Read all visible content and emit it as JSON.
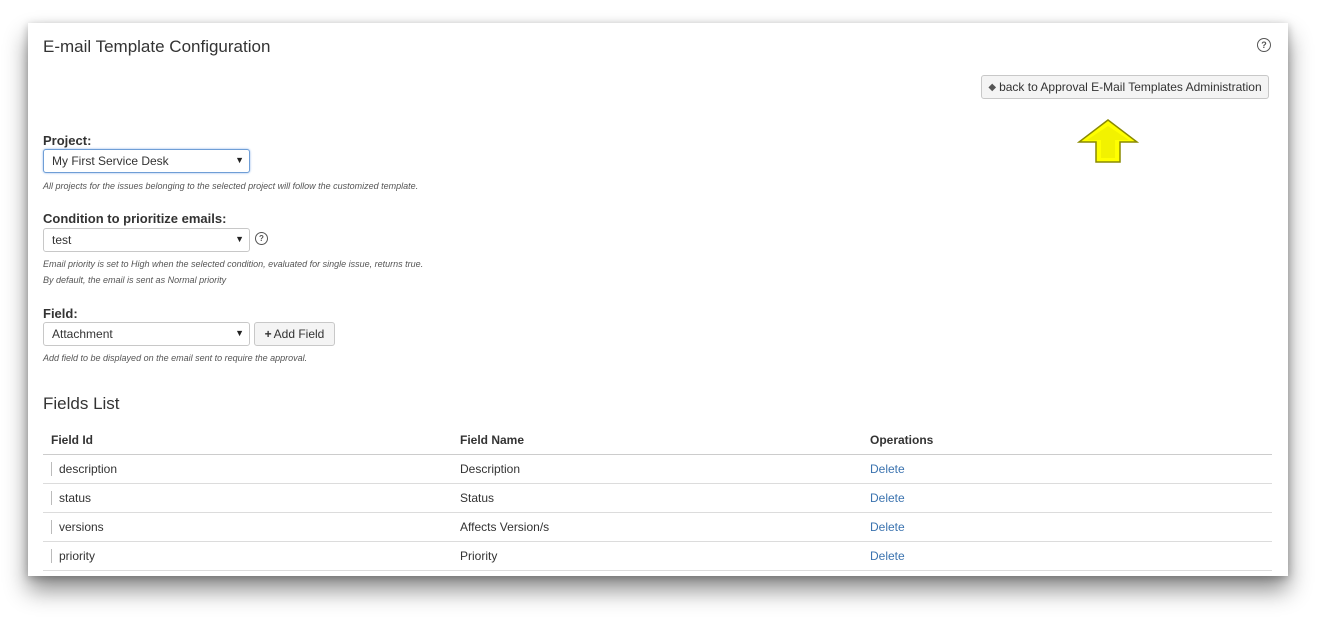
{
  "page": {
    "title": "E-mail Template Configuration",
    "help_glyph": "?",
    "back_button": {
      "arrow": "◆",
      "label": "back to Approval E-Mail Templates Administration"
    }
  },
  "project": {
    "label": "Project:",
    "value": "My First Service Desk",
    "hint": "All projects for the issues belonging to the selected project will follow the customized template."
  },
  "condition": {
    "label": "Condition to prioritize emails:",
    "value": "test",
    "hint_line1": "Email priority is set to High when the selected condition, evaluated for single issue, returns true.",
    "hint_line2": "By default, the email is sent as Normal priority"
  },
  "field": {
    "label": "Field:",
    "value": "Attachment",
    "add_button": {
      "icon": "+",
      "label": "Add Field"
    },
    "hint": "Add field to be displayed on the email sent to require the approval."
  },
  "fields_list": {
    "title": "Fields List",
    "columns": [
      "Field Id",
      "Field Name",
      "Operations"
    ],
    "rows": [
      {
        "id": "description",
        "name": "Description",
        "op": "Delete"
      },
      {
        "id": "status",
        "name": "Status",
        "op": "Delete"
      },
      {
        "id": "versions",
        "name": "Affects Version/s",
        "op": "Delete"
      },
      {
        "id": "priority",
        "name": "Priority",
        "op": "Delete"
      }
    ]
  },
  "colors": {
    "link": "#3b73af",
    "annotation_arrow": "#ffff00"
  },
  "icons": {
    "dropdown": "▼"
  }
}
